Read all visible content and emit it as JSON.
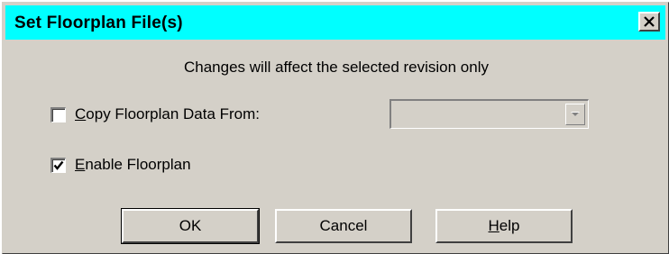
{
  "window": {
    "title": "Set Floorplan File(s)",
    "close_icon": "close-x-icon",
    "titlebar_color": "#00ffff",
    "face_color": "#d4d0c8"
  },
  "message": "Changes will affect the selected revision only",
  "copy_option": {
    "label_prefix": "",
    "label_accel": "C",
    "label_rest": "opy Floorplan Data From:",
    "checked": false,
    "combo_value": "",
    "combo_enabled": false
  },
  "enable_option": {
    "label_accel": "E",
    "label_rest": "nable Floorplan",
    "checked": true
  },
  "buttons": {
    "ok_label": "OK",
    "cancel_label": "Cancel",
    "help_accel": "H",
    "help_rest": "elp"
  }
}
